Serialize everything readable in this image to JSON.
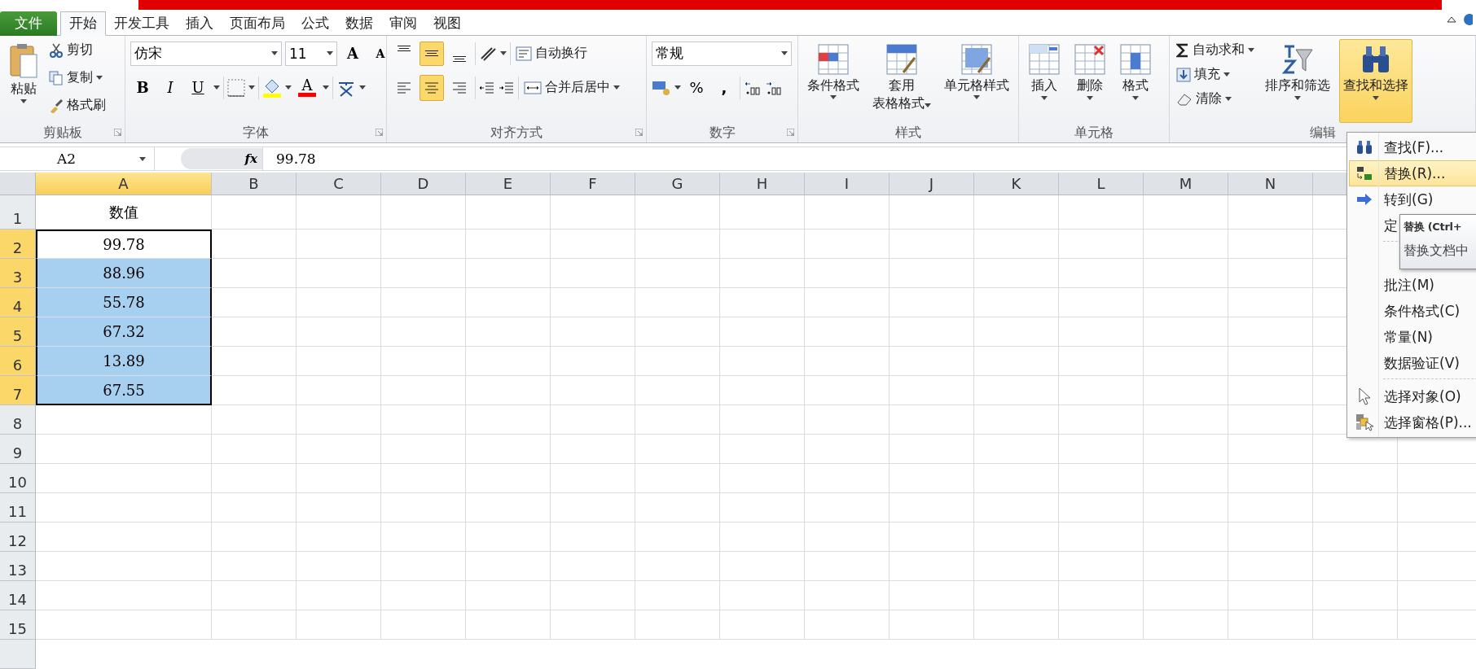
{
  "tabs": [
    {
      "label": "文件",
      "kind": "file",
      "selected": false
    },
    {
      "label": "开始",
      "kind": "tab",
      "selected": true
    },
    {
      "label": "开发工具",
      "kind": "tab",
      "selected": false
    },
    {
      "label": "插入",
      "kind": "tab",
      "selected": false
    },
    {
      "label": "页面布局",
      "kind": "tab",
      "selected": false
    },
    {
      "label": "公式",
      "kind": "tab",
      "selected": false
    },
    {
      "label": "数据",
      "kind": "tab",
      "selected": false
    },
    {
      "label": "审阅",
      "kind": "tab",
      "selected": false
    },
    {
      "label": "视图",
      "kind": "tab",
      "selected": false
    }
  ],
  "clipboard": {
    "label": "剪贴板",
    "paste": "粘贴",
    "cut": "剪切",
    "copy": "复制",
    "format_painter": "格式刷"
  },
  "font": {
    "label": "字体",
    "font_name": "仿宋",
    "font_size": "11",
    "grow": "A",
    "shrink": "A",
    "bold": "B",
    "italic": "I",
    "underline": "U",
    "font_color": "A"
  },
  "alignment": {
    "label": "对齐方式",
    "vertical": [
      {
        "selected": false
      },
      {
        "selected": true
      },
      {
        "selected": false
      }
    ],
    "horizontal": [
      {
        "selected": false
      },
      {
        "selected": true
      },
      {
        "selected": false
      }
    ],
    "wrap_text": "自动换行",
    "merge_center": "合并后居中"
  },
  "number": {
    "label": "数字",
    "format": "常规",
    "percent": "%",
    "comma": ","
  },
  "styles": {
    "label": "样式",
    "buttons": [
      {
        "lines": [
          "条件格式"
        ]
      },
      {
        "lines": [
          "套用",
          "表格格式"
        ]
      },
      {
        "lines": [
          "单元格样式"
        ]
      }
    ]
  },
  "cells": {
    "label": "单元格",
    "buttons": [
      "插入",
      "删除",
      "格式"
    ]
  },
  "editing": {
    "label": "编辑",
    "autosum": "自动求和",
    "fill": "填充",
    "clear": "清除",
    "sort_filter": "排序和筛选",
    "find_select": {
      "label": "查找和选择",
      "selected": true
    }
  },
  "formula_bar": {
    "name_box": "A2",
    "function_button": "fx",
    "value": "99.78"
  },
  "sheet": {
    "columns": [
      {
        "label": "A",
        "selected": true
      },
      {
        "label": "B",
        "selected": false
      },
      {
        "label": "C",
        "selected": false
      },
      {
        "label": "D",
        "selected": false
      },
      {
        "label": "E",
        "selected": false
      },
      {
        "label": "F",
        "selected": false
      },
      {
        "label": "G",
        "selected": false
      },
      {
        "label": "H",
        "selected": false
      },
      {
        "label": "I",
        "selected": false
      },
      {
        "label": "J",
        "selected": false
      },
      {
        "label": "K",
        "selected": false
      },
      {
        "label": "L",
        "selected": false
      },
      {
        "label": "M",
        "selected": false
      },
      {
        "label": "N",
        "selected": false
      }
    ],
    "rows": [
      {
        "label": "1",
        "selected": false,
        "cell": {
          "text": "数值",
          "selected": false
        }
      },
      {
        "label": "2",
        "selected": true,
        "cell": {
          "text": "99.78",
          "selected": true,
          "active": true
        }
      },
      {
        "label": "3",
        "selected": true,
        "cell": {
          "text": "88.96",
          "selected": true
        }
      },
      {
        "label": "4",
        "selected": true,
        "cell": {
          "text": "55.78",
          "selected": true
        }
      },
      {
        "label": "5",
        "selected": true,
        "cell": {
          "text": "67.32",
          "selected": true
        }
      },
      {
        "label": "6",
        "selected": true,
        "cell": {
          "text": "13.89",
          "selected": true
        }
      },
      {
        "label": "7",
        "selected": true,
        "cell": {
          "text": "67.55",
          "selected": true
        }
      },
      {
        "label": "8",
        "selected": false
      },
      {
        "label": "9",
        "selected": false
      },
      {
        "label": "10",
        "selected": false
      },
      {
        "label": "11",
        "selected": false
      },
      {
        "label": "12",
        "selected": false
      },
      {
        "label": "13",
        "selected": false
      },
      {
        "label": "14",
        "selected": false
      },
      {
        "label": "15",
        "selected": false
      }
    ]
  },
  "menu": {
    "items": [
      {
        "kind": "item",
        "label": "查找(F)...",
        "selected": false
      },
      {
        "kind": "item",
        "label": "替换(R)...",
        "selected": true
      },
      {
        "kind": "item",
        "label": "转到(G)",
        "selected": false
      },
      {
        "kind": "item",
        "label": "定",
        "selected": false
      },
      {
        "kind": "separator"
      },
      {
        "kind": "hidden"
      },
      {
        "kind": "item",
        "label": "批注(M)",
        "selected": false
      },
      {
        "kind": "item",
        "label": "条件格式(C)",
        "selected": false
      },
      {
        "kind": "item",
        "label": "常量(N)",
        "selected": false
      },
      {
        "kind": "item",
        "label": "数据验证(V)",
        "selected": false
      },
      {
        "kind": "separator"
      },
      {
        "kind": "item",
        "label": "选择对象(O)",
        "selected": false
      },
      {
        "kind": "item",
        "label": "选择窗格(P)...",
        "selected": false
      }
    ],
    "tooltip": {
      "title": "替换 (Ctrl+",
      "text": "替换文档中"
    }
  }
}
